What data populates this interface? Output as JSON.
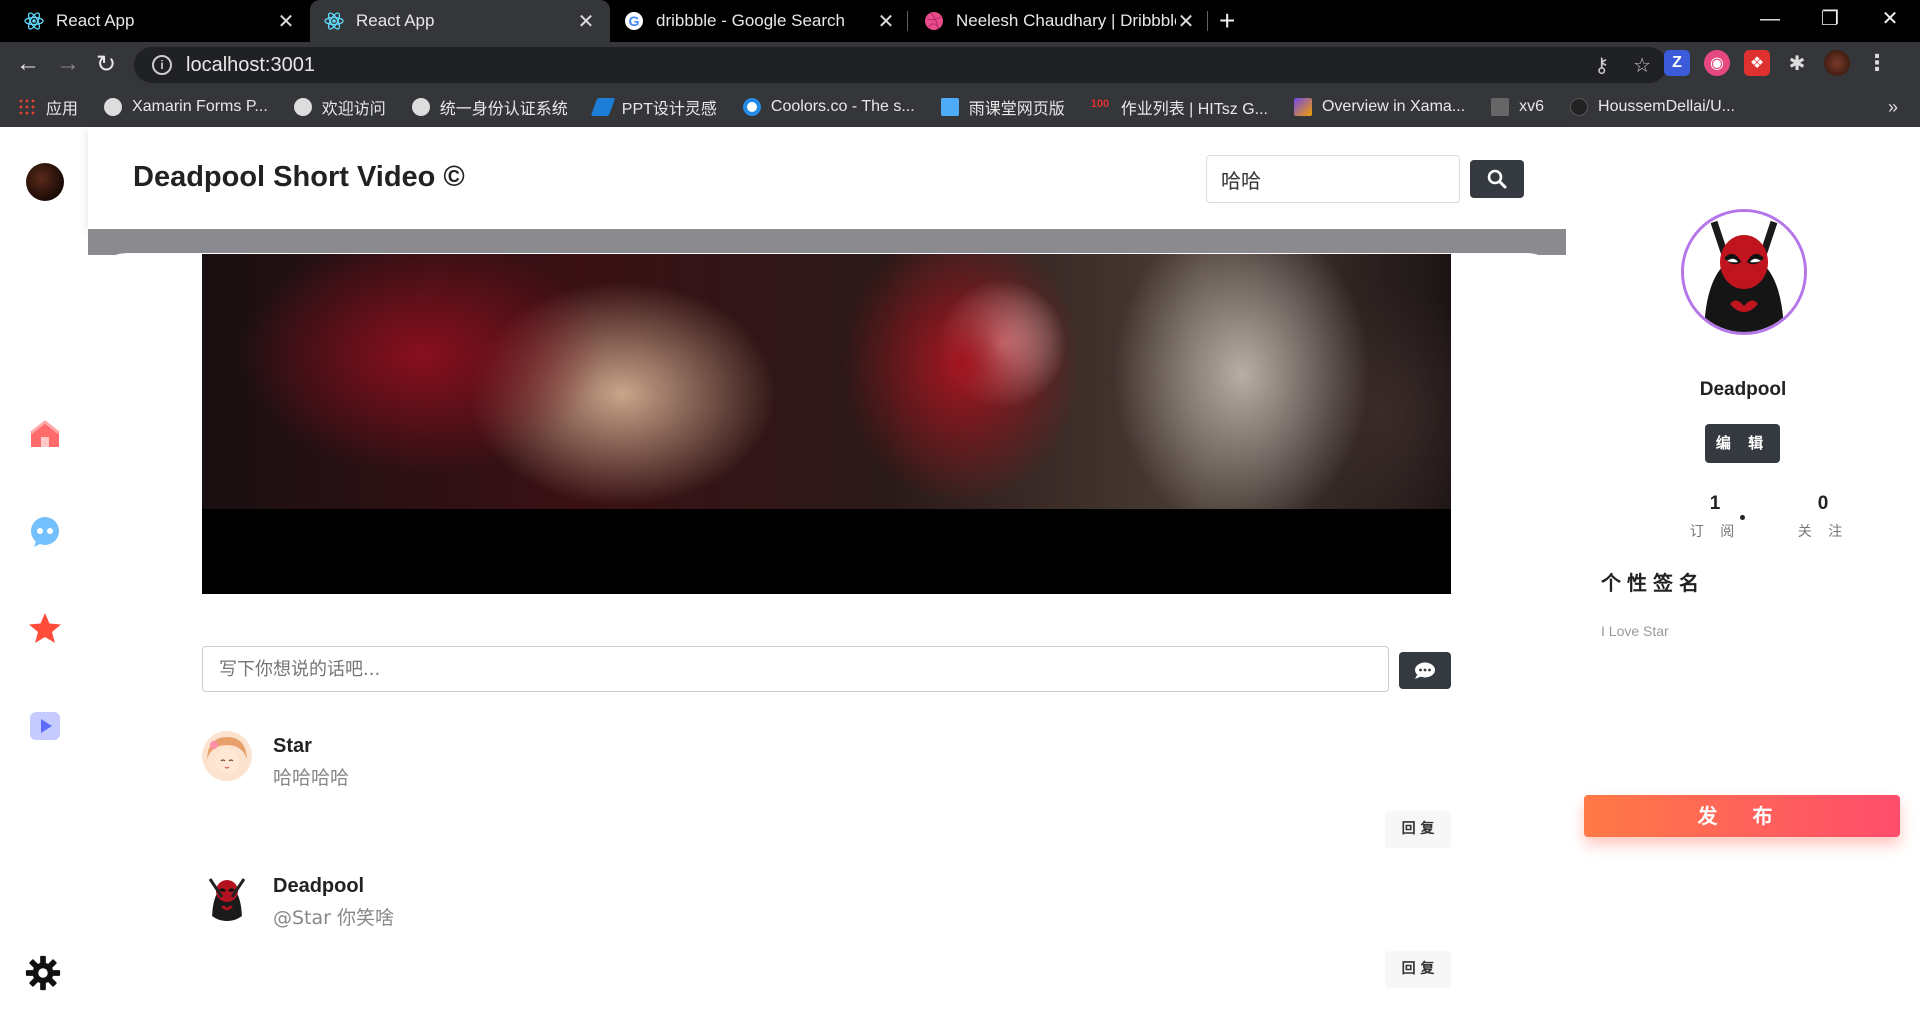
{
  "browser": {
    "tabs": [
      {
        "title": "React App",
        "icon": "react-icon",
        "active": false
      },
      {
        "title": "React App",
        "icon": "react-icon",
        "active": true
      },
      {
        "title": "dribbble - Google Search",
        "icon": "google-icon",
        "active": false
      },
      {
        "title": "Neelesh Chaudhary | Dribbble",
        "icon": "dribbble-icon",
        "active": false
      }
    ],
    "url": "localhost:3001",
    "bookmarks": [
      {
        "label": "应用",
        "icon": "apps-grid-icon"
      },
      {
        "label": "Xamarin Forms P...",
        "icon": "globe-icon"
      },
      {
        "label": "欢迎访问",
        "icon": "globe-icon"
      },
      {
        "label": "统一身份认证系统",
        "icon": "globe-icon"
      },
      {
        "label": "PPT设计灵感",
        "icon": "feather-icon"
      },
      {
        "label": "Coolors.co - The s...",
        "icon": "coolors-icon"
      },
      {
        "label": "雨课堂网页版",
        "icon": "rain-classroom-icon"
      },
      {
        "label": "作业列表 | HITsz G...",
        "icon": "hundred-icon"
      },
      {
        "label": "Overview in Xama...",
        "icon": "xamarin-icon"
      },
      {
        "label": "xv6",
        "icon": "pdos-icon"
      },
      {
        "label": "HoussemDellai/U...",
        "icon": "github-icon"
      }
    ]
  },
  "header": {
    "title": "Deadpool Short Video ©",
    "search_value": "哈哈"
  },
  "comment_box": {
    "placeholder": "写下你想说的话吧..."
  },
  "comments": [
    {
      "name": "Star",
      "text": "哈哈哈哈",
      "reply_label": "回 复"
    },
    {
      "name": "Deadpool",
      "text": "@Star 你笑啥",
      "reply_label": "回 复"
    }
  ],
  "profile": {
    "name": "Deadpool",
    "edit_label": "编 辑",
    "subscribe_count": "1",
    "subscribe_label": "订 阅",
    "follow_count": "0",
    "follow_label": "关 注",
    "signature_title": "个性签名",
    "signature_text": "I Love Star",
    "publish_label": "发 布"
  },
  "colors": {
    "dark_button": "#343a40",
    "publish_gradient_start": "#ff7a45",
    "publish_gradient_end": "#ff4d6d",
    "avatar_ring": "#b476e8"
  }
}
